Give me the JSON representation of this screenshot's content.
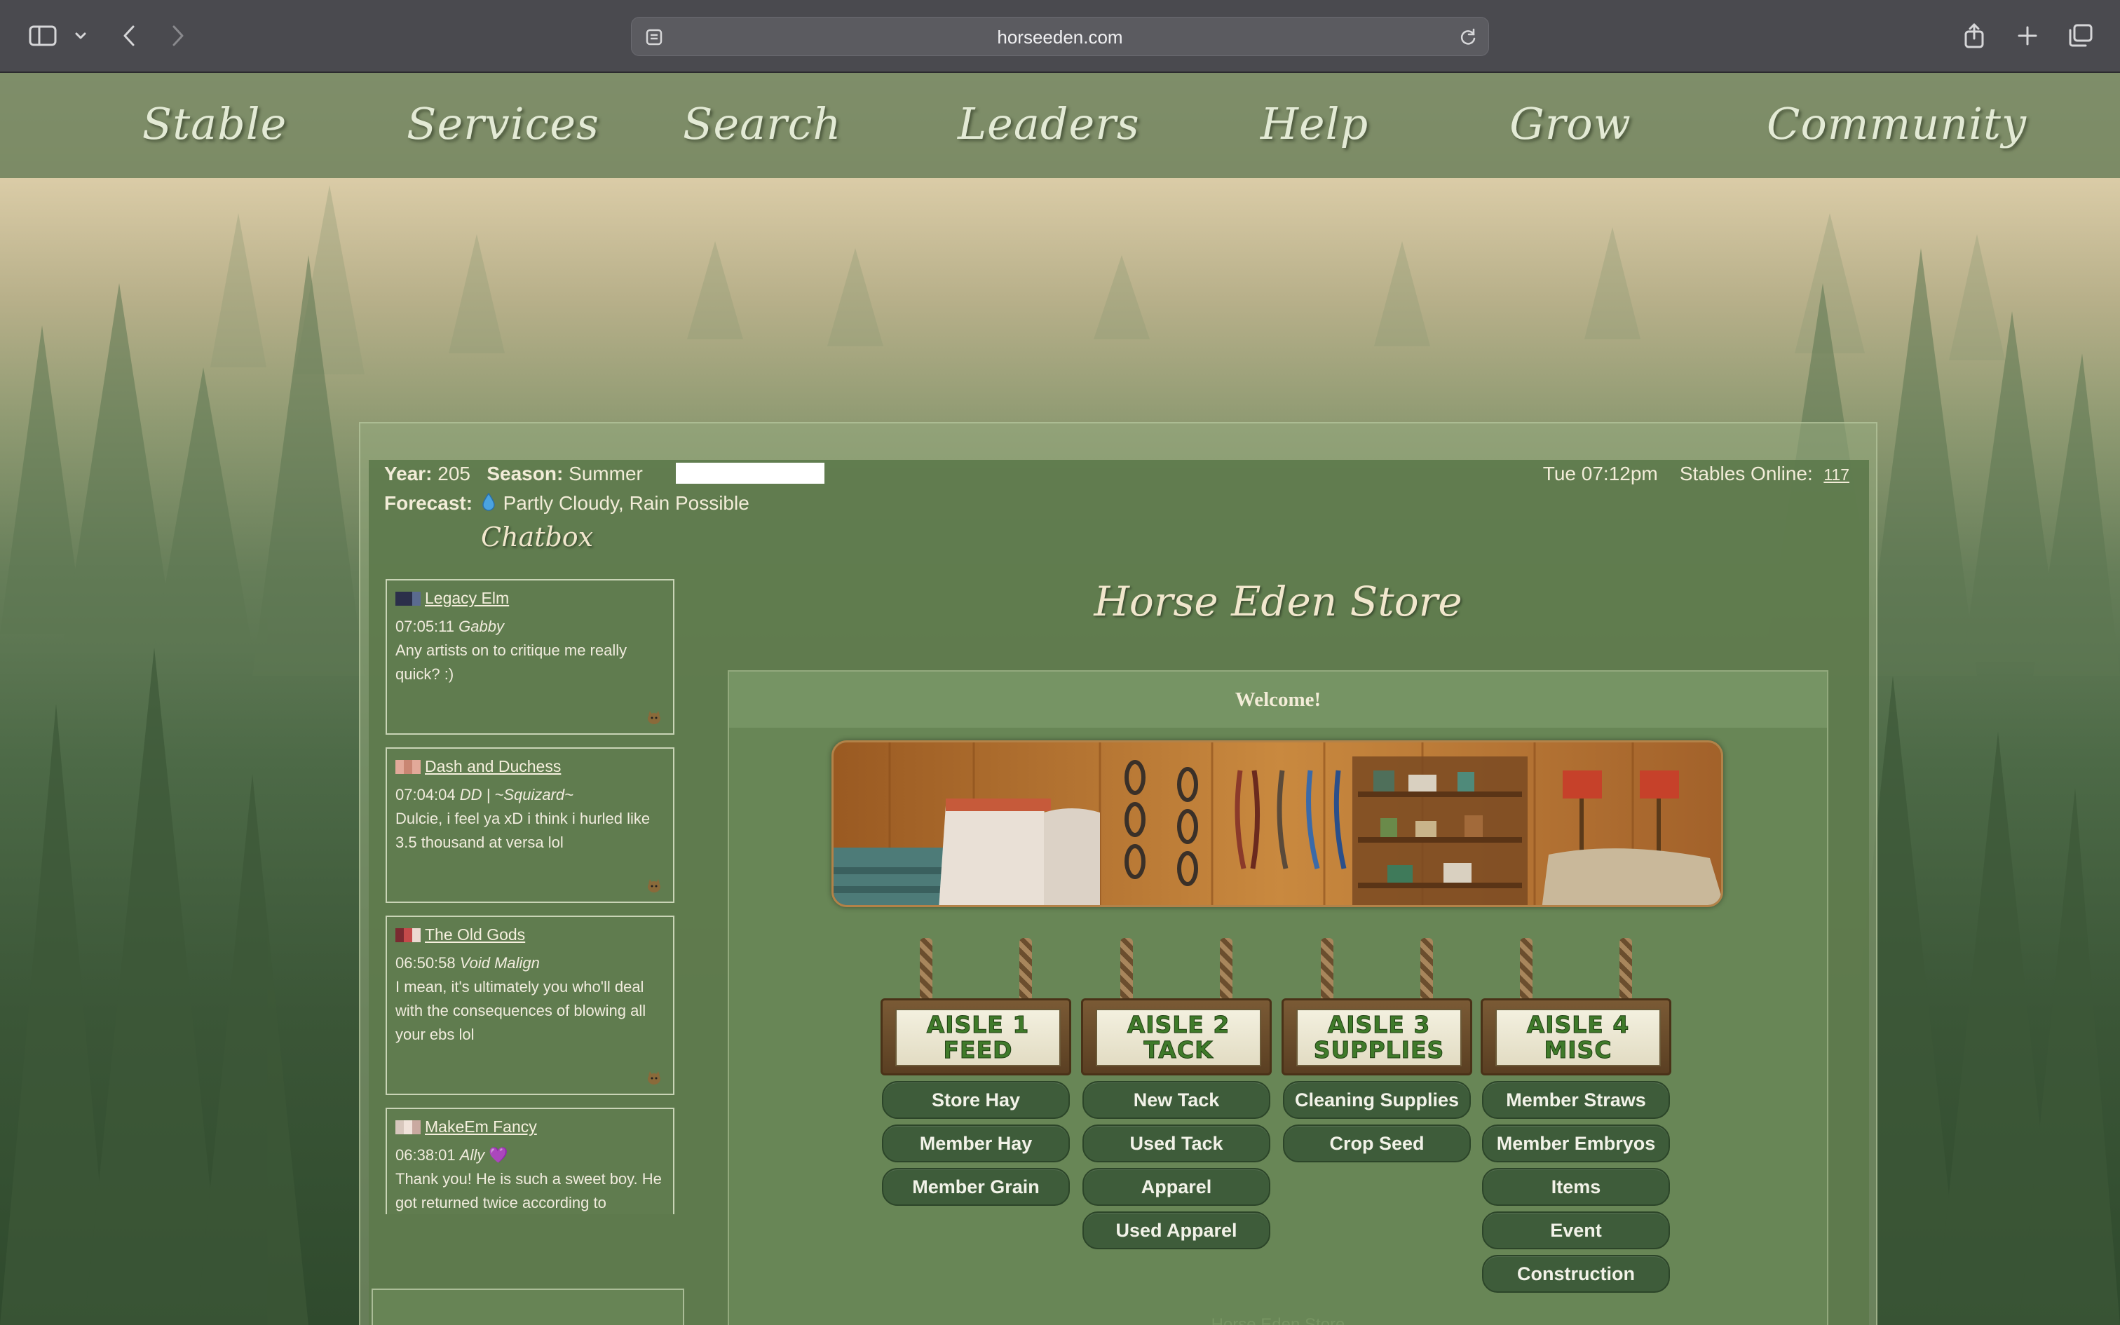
{
  "browser": {
    "url": "horseeden.com"
  },
  "topnav": {
    "items": [
      "Stable",
      "Services",
      "Search",
      "Leaders",
      "Help",
      "Grow",
      "Community"
    ]
  },
  "status": {
    "year_label": "Year:",
    "year": "205",
    "season_label": "Season:",
    "season": "Summer",
    "forecast_label": "Forecast:",
    "forecast": "Partly Cloudy, Rain Possible",
    "forecast_icon": "raindrop-icon",
    "datetime": "Tue 07:12pm",
    "online_label": "Stables Online:",
    "online_count": "117"
  },
  "chatbox": {
    "title": "Chatbox",
    "messages": [
      {
        "user": "Legacy Elm",
        "time": "07:05:11",
        "alias": "Gabby",
        "text": "Any artists on to critique me really quick? :)",
        "flag_colors": [
          "#2b2f4a",
          "#2b2f4a",
          "#5b6b8f"
        ]
      },
      {
        "user": "Dash and Duchess",
        "time": "07:04:04",
        "alias": "DD | ~Squizard~",
        "text": "Dulcie, i feel ya xD i think i hurled like 3.5 thousand at versa lol",
        "flag_colors": [
          "#e2a999",
          "#c98673",
          "#e2a999"
        ]
      },
      {
        "user": "The Old Gods",
        "time": "06:50:58",
        "alias": "Void Malign",
        "text": "I mean, it's ultimately you who'll deal with the consequences of blowing all your ebs lol",
        "flag_colors": [
          "#7a2a30",
          "#c44a4a",
          "#ecd9d2"
        ]
      },
      {
        "user": "MakeEm Fancy",
        "time": "06:38:01",
        "alias": "Ally",
        "alias_emoji": "💜",
        "text": "Thank you! He is such a sweet boy. He got returned twice according to",
        "flag_colors": [
          "#d8c7bd",
          "#f0e2da",
          "#c9a9a0"
        ]
      }
    ]
  },
  "store": {
    "title": "Horse Eden Store",
    "welcome": "Welcome!",
    "footer_text": "Horse Eden Store",
    "aisles": [
      {
        "sign": [
          "AISLE 1",
          "FEED"
        ],
        "buttons": [
          "Store Hay",
          "Member Hay",
          "Member Grain"
        ]
      },
      {
        "sign": [
          "AISLE 2",
          "TACK"
        ],
        "buttons": [
          "New Tack",
          "Used Tack",
          "Apparel",
          "Used Apparel"
        ]
      },
      {
        "sign": [
          "AISLE 3",
          "SUPPLIES"
        ],
        "buttons": [
          "Cleaning Supplies",
          "Crop Seed"
        ]
      },
      {
        "sign": [
          "AISLE 4",
          "MISC"
        ],
        "buttons": [
          "Member Straws",
          "Member Embryos",
          "Items",
          "Event",
          "Construction"
        ]
      }
    ]
  },
  "colors": {
    "chrome": "#4a4a4f",
    "nav_bg": "#6e825c",
    "panel": "#5d7a4c",
    "button": "#3e5c3a",
    "sign_text": "#3f7a2a"
  }
}
